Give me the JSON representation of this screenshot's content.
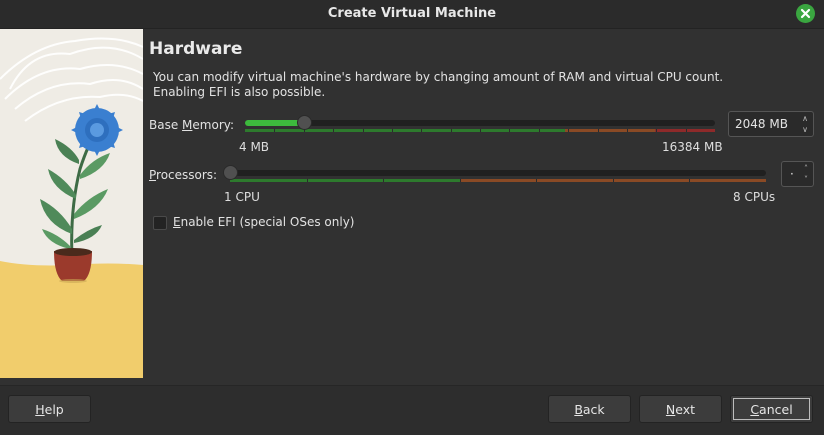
{
  "window": {
    "title": "Create Virtual Machine"
  },
  "page": {
    "heading": "Hardware",
    "description_line1": "You can modify virtual machine's hardware by changing amount of RAM and virtual CPU count.",
    "description_line2": "Enabling EFI is also possible."
  },
  "memory": {
    "label_pre": "Base ",
    "label_mnemonic": "M",
    "label_post": "emory:",
    "value": "2048 MB",
    "level": 0.125,
    "min_label": "4 MB",
    "max_label": "16384 MB"
  },
  "processors": {
    "label_mnemonic": "P",
    "label_post": "rocessors:",
    "value": "·",
    "level": 0,
    "min_label": "1 CPU",
    "max_label": "8 CPUs"
  },
  "efi": {
    "label_mnemonic": "E",
    "label_post": "nable EFI (special OSes only)",
    "checked": false
  },
  "buttons": {
    "help_mnemonic": "H",
    "help_rest": "elp",
    "back_mnemonic": "B",
    "back_rest": "ack",
    "next_mnemonic": "N",
    "next_rest": "ext",
    "cancel_mnemonic": "C",
    "cancel_rest": "ancel"
  },
  "colors": {
    "accent_green": "#3dba3d",
    "scale_safe": "#2d7a2d",
    "scale_warn": "#8a4a25",
    "scale_danger": "#8e2a2a",
    "close_button": "#3aa640"
  },
  "icons": {
    "close": "close-icon",
    "spin_up": "chevron-up-icon",
    "spin_down": "chevron-down-icon"
  }
}
